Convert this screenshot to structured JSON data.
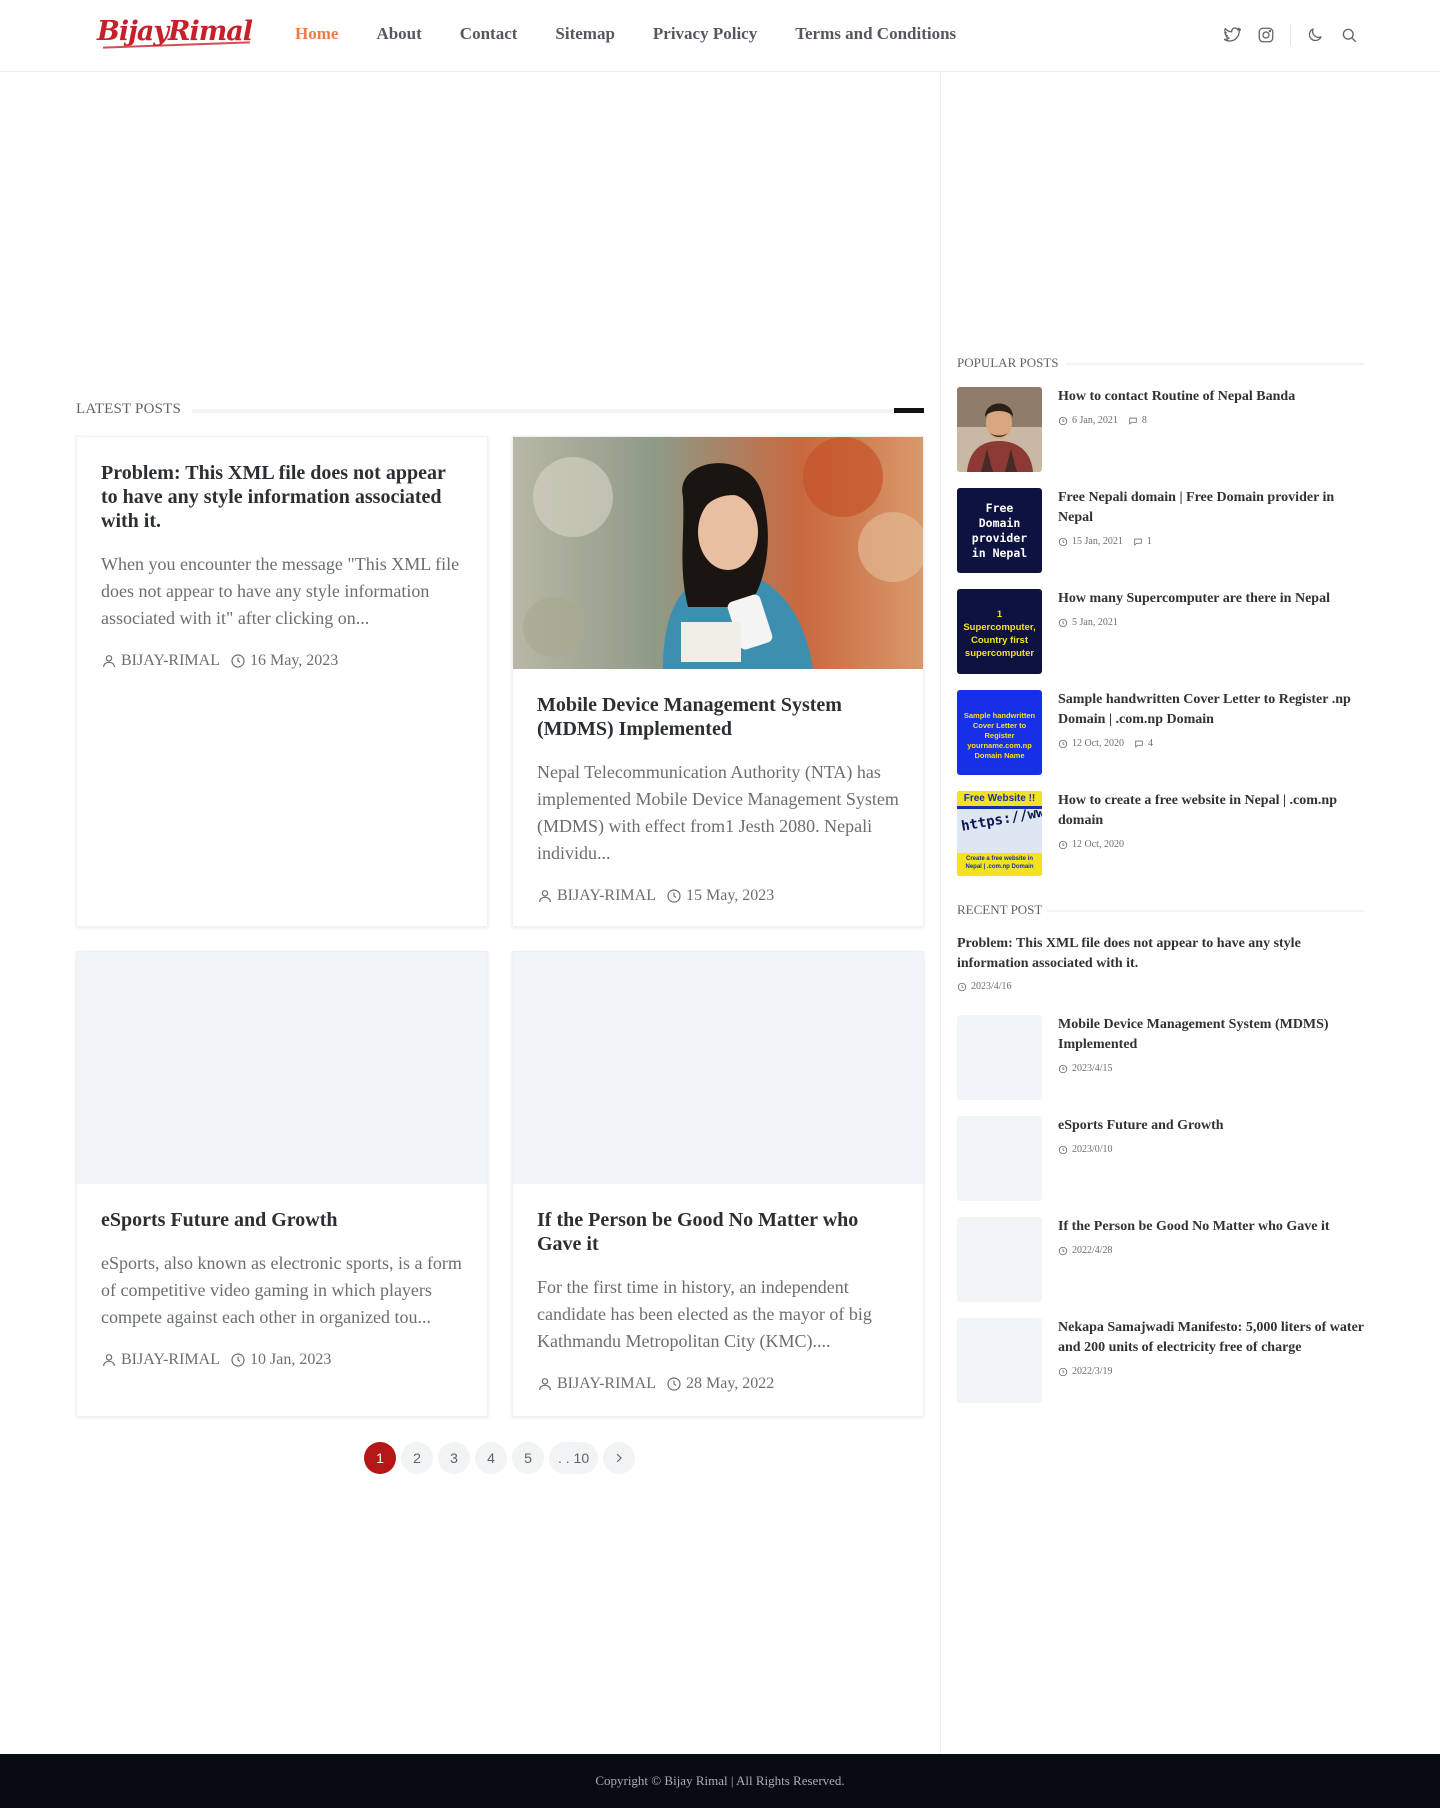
{
  "brand": {
    "logo_text": "BijayRimal",
    "accent_color": "#ef7b45",
    "primary_red": "#b51616"
  },
  "nav": {
    "items": [
      {
        "label": "Home",
        "active": true
      },
      {
        "label": "About"
      },
      {
        "label": "Contact"
      },
      {
        "label": "Sitemap"
      },
      {
        "label": "Privacy Policy"
      },
      {
        "label": "Terms and Conditions"
      }
    ],
    "icons": [
      "twitter-icon",
      "instagram-icon",
      "moon-icon",
      "search-icon"
    ]
  },
  "latest": {
    "heading": "LATEST POSTS",
    "posts": [
      {
        "title": "Problem: This XML file does not appear to have any style information associated with it.",
        "excerpt": "When you encounter the message \"This XML file does not appear to have any style information associated with it\" after clicking on...",
        "author": "BIJAY-RIMAL",
        "date": "16 May, 2023"
      },
      {
        "title": "Mobile Device Management System (MDMS) Implemented",
        "excerpt": "Nepal Telecommunication Authority (NTA) has implemented Mobile Device Management System (MDMS) with effect from1 Jesth 2080. Nepali individu...",
        "author": "BIJAY-RIMAL",
        "date": "15 May, 2023"
      },
      {
        "title": "eSports Future and Growth",
        "excerpt": "eSports, also known as electronic sports, is a form of competitive video gaming in which players compete against each other in organized tou...",
        "author": "BIJAY-RIMAL",
        "date": "10 Jan, 2023"
      },
      {
        "title": "If the Person be Good No Matter who Gave it",
        "excerpt": "For the first time in history, an independent candidate has been elected as the mayor of  big Kathmandu Metropolitan City (KMC)....",
        "author": "BIJAY-RIMAL",
        "date": "28 May, 2022"
      }
    ]
  },
  "pagination": {
    "pages": [
      "1",
      "2",
      "3",
      "4",
      "5",
      ". . 10"
    ],
    "current": "1",
    "next_icon": "chevron-right-icon"
  },
  "popular": {
    "heading": "POPULAR POSTS",
    "posts": [
      {
        "title": "How to contact Routine of Nepal Banda",
        "date": "6 Jan, 2021",
        "comments": "8"
      },
      {
        "title": "Free Nepali domain | Free Domain provider in Nepal",
        "date": "15 Jan, 2021",
        "comments": "1",
        "thumb_text": "Free Domain provider in Nepal"
      },
      {
        "title": "How many Supercomputer are there in Nepal",
        "date": "5 Jan, 2021",
        "thumb_text": "1 Supercomputer, Country first supercomputer"
      },
      {
        "title": "Sample handwritten Cover Letter to Register .np Domain | .com.np Domain",
        "date": "12 Oct, 2020",
        "comments": "4",
        "thumb_text": "Sample handwritten Cover Letter to Register yourname.com.np Domain Name"
      },
      {
        "title": "How to create a free website in Nepal | .com.np domain",
        "date": "12 Oct, 2020",
        "thumb_text": "Free Website !!",
        "thumb_url_text": "https://www",
        "thumb_caption": "Create a free website in Nepal | .com.np Domain"
      }
    ]
  },
  "recent": {
    "heading": "RECENT POST",
    "posts": [
      {
        "title": "Problem: This XML file does not appear to have any style information associated with it.",
        "date": "2023/4/16"
      },
      {
        "title": "Mobile Device Management System (MDMS) Implemented",
        "date": "2023/4/15"
      },
      {
        "title": "eSports Future and Growth",
        "date": "2023/0/10"
      },
      {
        "title": "If the Person be Good No Matter who Gave it",
        "date": "2022/4/28"
      },
      {
        "title": "Nekapa Samajwadi Manifesto: 5,000 liters of water and 200 units of electricity free of charge",
        "date": "2022/3/19"
      }
    ]
  },
  "footer": {
    "text": "Copyright © Bijay Rimal | All Rights Reserved."
  }
}
